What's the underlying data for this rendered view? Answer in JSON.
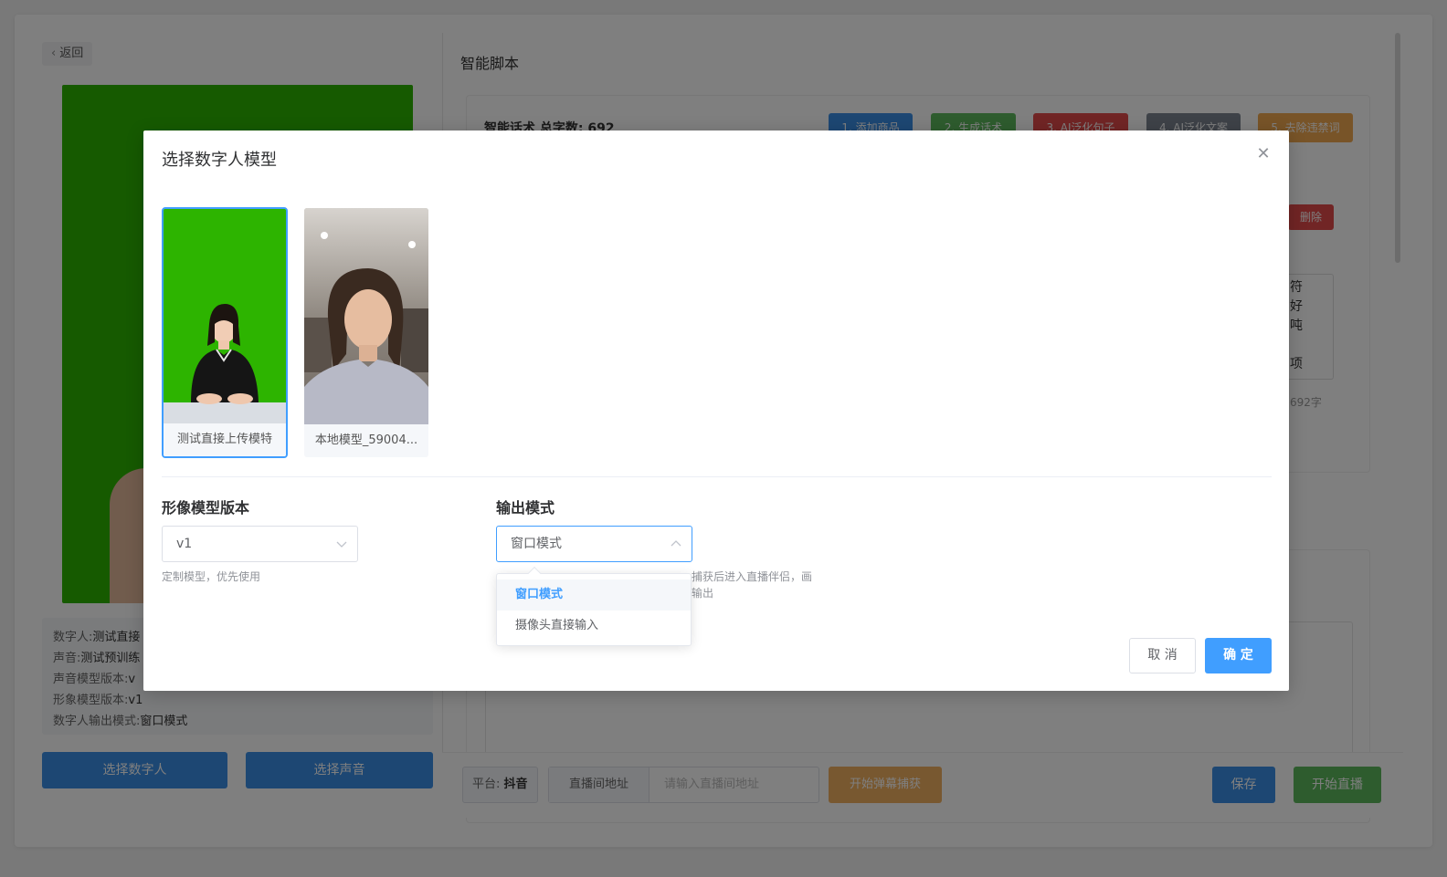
{
  "background": {
    "back_label": "返回",
    "section_title": "智能脚本",
    "script_head": "智能话术   总字数: 692",
    "tags": [
      {
        "label": "1. 添加商品",
        "color": "#3a8ee6"
      },
      {
        "label": "2. 生成话术",
        "color": "#5cb85c"
      },
      {
        "label": "3. AI泛化句子",
        "color": "#e34b4b"
      },
      {
        "label": "4. AI泛化文案",
        "color": "#7d8590"
      },
      {
        "label": "5. 去除违禁词",
        "color": "#f0a850"
      }
    ],
    "delete_label": "删除",
    "textarea_peek": "符\n好\n吨\n\n项",
    "count_peek": "692字",
    "info": [
      {
        "key": "数字人:",
        "val": "测试直接"
      },
      {
        "key": "声音:",
        "val": "测试预训练"
      },
      {
        "key": "声音模型版本:",
        "val": "v"
      },
      {
        "key": "形象模型版本:",
        "val": "v1"
      },
      {
        "key": "数字人输出模式:",
        "val": "窗口模式"
      }
    ],
    "choose_avatar_label": "选择数字人",
    "choose_voice_label": "选择声音",
    "platform_label": "平台:",
    "platform_value": "抖音",
    "url_label": "直播间地址",
    "url_placeholder": "请输入直播间地址",
    "capture_label": "开始弹幕捕获",
    "save_label": "保存",
    "start_live_label": "开始直播"
  },
  "modal": {
    "title": "选择数字人模型",
    "close_icon": "close-icon",
    "models": [
      {
        "name": "测试直接上传模特",
        "selected": true
      },
      {
        "name": "本地模型_59004...",
        "selected": false
      }
    ],
    "version": {
      "label": "形像模型版本",
      "value": "v1",
      "hint": "定制模型，优先使用"
    },
    "output": {
      "label": "输出模式",
      "value": "窗口模式",
      "hint_line1": "捕获后进入直播伴侣，画",
      "hint_line2": "输出",
      "options": [
        {
          "label": "窗口模式",
          "active": true
        },
        {
          "label": "摄像头直接输入",
          "active": false
        }
      ]
    },
    "cancel_label": "取 消",
    "ok_label": "确 定"
  },
  "colors": {
    "primary": "#409eff",
    "green_screen": "#2db400"
  }
}
